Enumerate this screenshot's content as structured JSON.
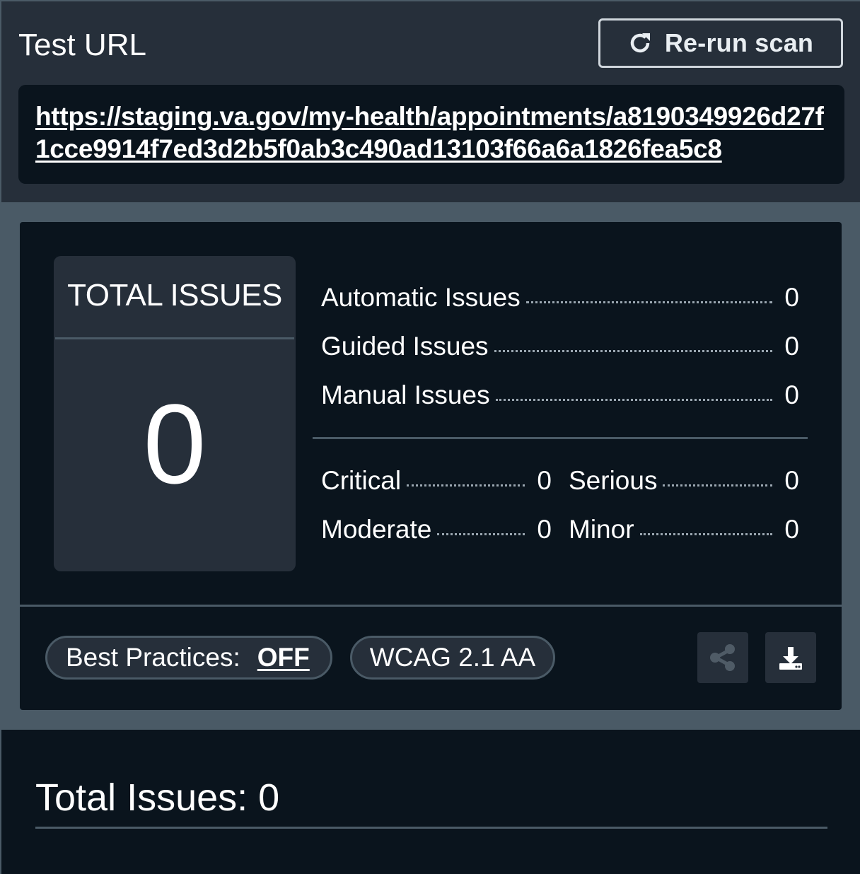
{
  "header": {
    "title": "Test URL",
    "rerun_label": "Re-run scan",
    "url": "https://staging.va.gov/my-health/appointments/a8190349926d27f1cce9914f7ed3d2b5f0ab3c490ad13103f66a6a1826fea5c8"
  },
  "summary": {
    "total_label": "TOTAL ISSUES",
    "total_value": "0",
    "by_type": [
      {
        "label": "Automatic Issues",
        "value": "0"
      },
      {
        "label": "Guided Issues",
        "value": "0"
      },
      {
        "label": "Manual Issues",
        "value": "0"
      }
    ],
    "by_impact": [
      {
        "label": "Critical",
        "value": "0"
      },
      {
        "label": "Serious",
        "value": "0"
      },
      {
        "label": "Moderate",
        "value": "0"
      },
      {
        "label": "Minor",
        "value": "0"
      }
    ]
  },
  "footer": {
    "best_practices_label": "Best Practices:",
    "best_practices_value": "OFF",
    "standard": "WCAG 2.1 AA",
    "share_icon": "share-icon",
    "export_icon": "download-icon"
  },
  "results": {
    "heading": "Total Issues: 0"
  },
  "colors": {
    "background": "#0a141d",
    "panel": "#262f3a",
    "band": "#4a5a66",
    "text": "#ffffff"
  }
}
